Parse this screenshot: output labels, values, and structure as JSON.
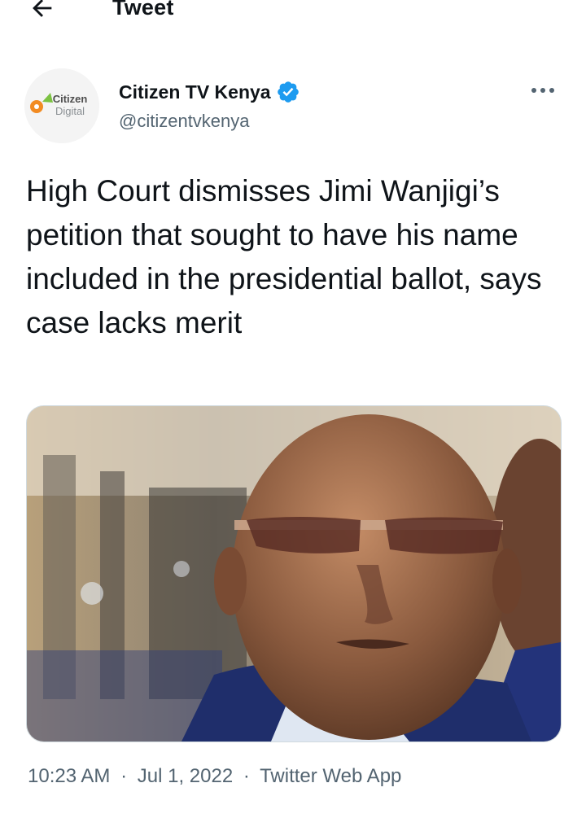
{
  "header": {
    "title": "Tweet",
    "back_icon": "arrow-left-icon"
  },
  "author": {
    "name": "Citizen TV Kenya",
    "handle": "@citizentvkenya",
    "verified_icon": "verified-badge-icon",
    "avatar_logo_text_1": "Citizen",
    "avatar_logo_text_2": "Digital"
  },
  "more_icon": "more-horizontal-icon",
  "tweet": {
    "text": "High Court dismisses Jimi Wanjigi’s petition that sought to have his name included in the presidential ballot, says case lacks merit"
  },
  "meta": {
    "time": "10:23 AM",
    "separator": "·",
    "date": "Jul 1, 2022",
    "source": "Twitter Web App"
  },
  "colors": {
    "text": "#0f1419",
    "secondary": "#536471",
    "verified": "#1d9bf0",
    "logo_orange": "#f28b22",
    "logo_gray": "#8a8f93"
  }
}
